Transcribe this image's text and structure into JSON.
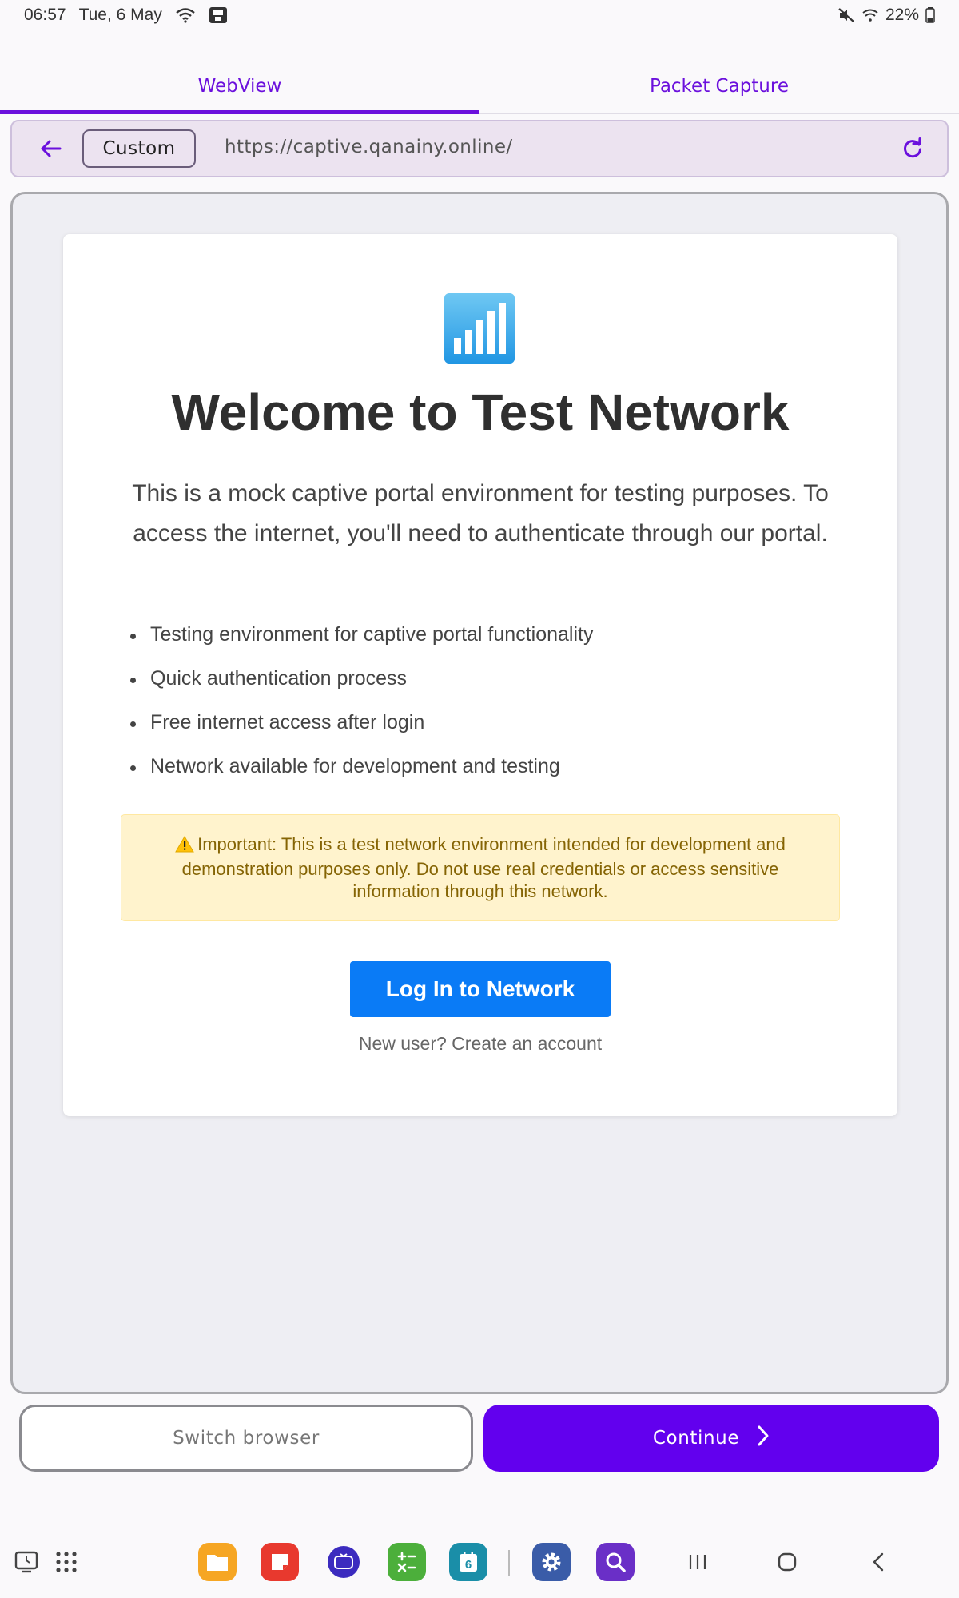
{
  "status_bar": {
    "time": "06:57",
    "date": "Tue, 6 May",
    "battery": "22%"
  },
  "tabs": [
    {
      "label": "WebView",
      "active": true
    },
    {
      "label": "Packet Capture",
      "active": false
    }
  ],
  "url_bar": {
    "mode_label": "Custom",
    "url": "https://captive.qanainy.online/"
  },
  "portal": {
    "icon": "antenna-bars-icon",
    "title": "Welcome to Test Network",
    "description": "This is a mock captive portal environment for testing purposes. To access the internet, you'll need to authenticate through our portal.",
    "features": [
      "Testing environment for captive portal functionality",
      "Quick authentication process",
      "Free internet access after login",
      "Network available for development and testing"
    ],
    "warning": "Important: This is a test network environment intended for development and demonstration purposes only. Do not use real credentials or access sensitive information through this network.",
    "login_button": "Log In to Network",
    "signup_link": "New user? Create an account"
  },
  "actions": {
    "switch_label": "Switch browser",
    "continue_label": "Continue"
  },
  "colors": {
    "accent": "#6200ee",
    "tab_accent": "#6b10dd",
    "login_blue": "#0a7bf6",
    "warning_bg": "#fff3cd",
    "warning_text": "#856404"
  },
  "dock": {
    "apps": [
      "recent-apps-icon",
      "app-drawer-icon",
      "files-icon",
      "notes-icon",
      "iptv-icon",
      "calculator-icon",
      "calendar-icon",
      "settings-icon",
      "web-search-icon"
    ],
    "calendar_day": "6",
    "nav": [
      "recents-nav-icon",
      "home-nav-icon",
      "back-nav-icon"
    ]
  }
}
